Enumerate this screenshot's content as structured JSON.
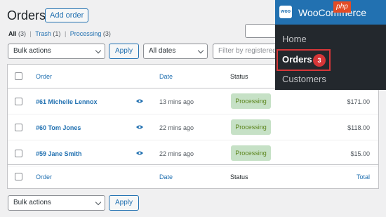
{
  "header": {
    "title": "Orders",
    "add_order_label": "Add order"
  },
  "views": {
    "all": "All",
    "all_count": "(3)",
    "trash": "Trash",
    "trash_count": "(1)",
    "processing": "Processing",
    "processing_count": "(3)"
  },
  "bulk_actions": {
    "selected": "Bulk actions",
    "apply_label": "Apply"
  },
  "date_filter": {
    "selected": "All dates"
  },
  "customer_filter": {
    "placeholder": "Filter by registered c"
  },
  "table": {
    "columns": {
      "order": "Order",
      "date": "Date",
      "status": "Status",
      "total": "Total"
    },
    "rows": [
      {
        "order": "#61 Michelle Lennox",
        "date": "13 mins ago",
        "status": "Processing",
        "total": "$171.00"
      },
      {
        "order": "#60 Tom Jones",
        "date": "22 mins ago",
        "status": "Processing",
        "total": "$118.00"
      },
      {
        "order": "#59 Jane Smith",
        "date": "22 mins ago",
        "status": "Processing",
        "total": "$15.00"
      }
    ]
  },
  "woocommerce_menu": {
    "logo": "woo",
    "title": "WooCommerce",
    "badge": "php",
    "items": {
      "home": "Home",
      "orders": "Orders",
      "orders_count": "3",
      "customers": "Customers"
    }
  },
  "colors": {
    "accent": "#2271b1",
    "processing_bg": "#c6e1c6",
    "processing_text": "#5b841b",
    "menu_bg": "#23282d",
    "highlight": "#d63638"
  }
}
